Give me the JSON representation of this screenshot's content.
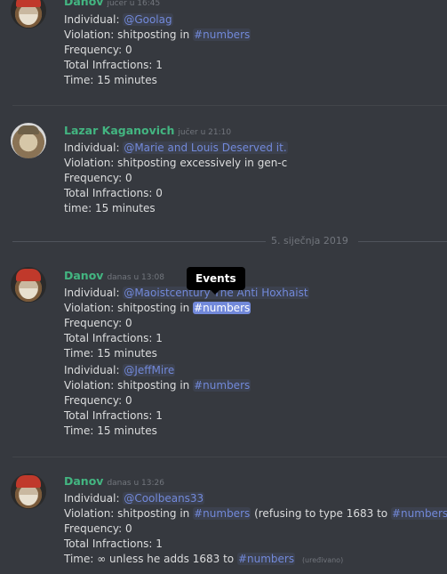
{
  "messages": [
    {
      "author": "Danov",
      "timestamp": "jučer u 16:45",
      "lines": [
        {
          "label": "Individual:",
          "mention": "@Goolag"
        },
        {
          "text": "Violation: shitposting in",
          "channel": "#numbers"
        },
        {
          "text": "Frequency: 0"
        },
        {
          "text": "Total Infractions: 1"
        },
        {
          "text": "Time: 15 minutes"
        }
      ]
    },
    {
      "author": "Lazar Kaganovich",
      "timestamp": "jučer u 21:10",
      "lines": [
        {
          "label": "Individual:",
          "mention": "@Marie and Louis Deserved it."
        },
        {
          "text": "Violation: shitposting excessively in gen-c"
        },
        {
          "text": "Frequency: 0"
        },
        {
          "text": "Total Infractions: 0"
        },
        {
          "text": "time: 15 minutes"
        }
      ]
    },
    {
      "author": "Danov",
      "timestamp": "danas u 13:08",
      "lines": [
        {
          "label": "Individual:",
          "mention": "@Maoistcentury The Anti Hoxhaist"
        },
        {
          "text": "Violation: shitposting in",
          "channel": "#numbers"
        },
        {
          "text": "Frequency: 0"
        },
        {
          "text": "Total Infractions: 1"
        },
        {
          "text": "Time: 15 minutes"
        },
        {
          "label": "Individual:",
          "mention": "@JeffMire"
        },
        {
          "text": "Violation: shitposting in",
          "channel": "#numbers"
        },
        {
          "text": "Frequency: 0"
        },
        {
          "text": "Total Infractions: 1"
        },
        {
          "text": "Time: 15 minutes"
        }
      ]
    },
    {
      "author": "Danov",
      "timestamp": "danas u 13:26",
      "lines": [
        {
          "label": "Individual:",
          "mention": "@Coolbeans33"
        },
        {
          "text": "Violation: shitposting in",
          "channel": "#numbers",
          "after": "(refusing to type 1683 to",
          "channel2": "#numbers",
          "end": ")"
        },
        {
          "text": "Frequency: 0"
        },
        {
          "text": "Total Infractions: 1"
        },
        {
          "text": "Time: ∞ unless he adds 1683 to",
          "channel": "#numbers",
          "edited": "(uređivano)"
        }
      ]
    }
  ],
  "date_divider": "5. siječnja 2019",
  "tooltip": "Events"
}
